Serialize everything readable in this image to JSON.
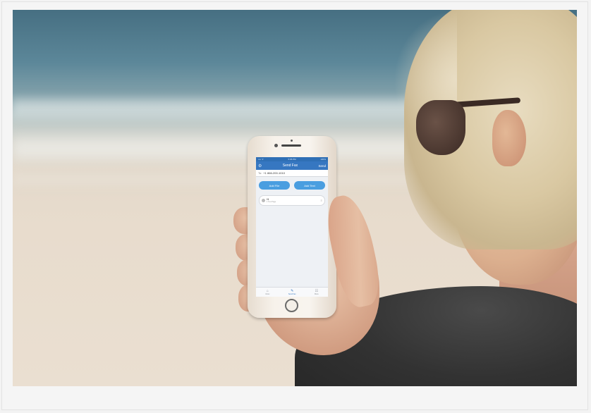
{
  "phone_screen": {
    "status": {
      "carrier": "•••• ᯤ",
      "time": "5:05 PM",
      "battery": "100%"
    },
    "nav": {
      "title": "Send Fax",
      "send_label": "Send",
      "settings_icon": "gear-icon"
    },
    "recipient": {
      "label": "To:",
      "number": "+1 866-200-1010"
    },
    "buttons": {
      "add_file": "Add File",
      "add_text": "Add Text"
    },
    "attachment": {
      "name": "Hi",
      "subtitle": "1 Text Page"
    },
    "tabs": [
      {
        "label": "Inbox",
        "icon": "inbox-icon"
      },
      {
        "label": "Send Fax",
        "icon": "compose-icon"
      },
      {
        "label": "More",
        "icon": "more-icon"
      }
    ],
    "colors": {
      "nav_blue": "#3677c1",
      "button_blue": "#4a9ee0"
    }
  }
}
